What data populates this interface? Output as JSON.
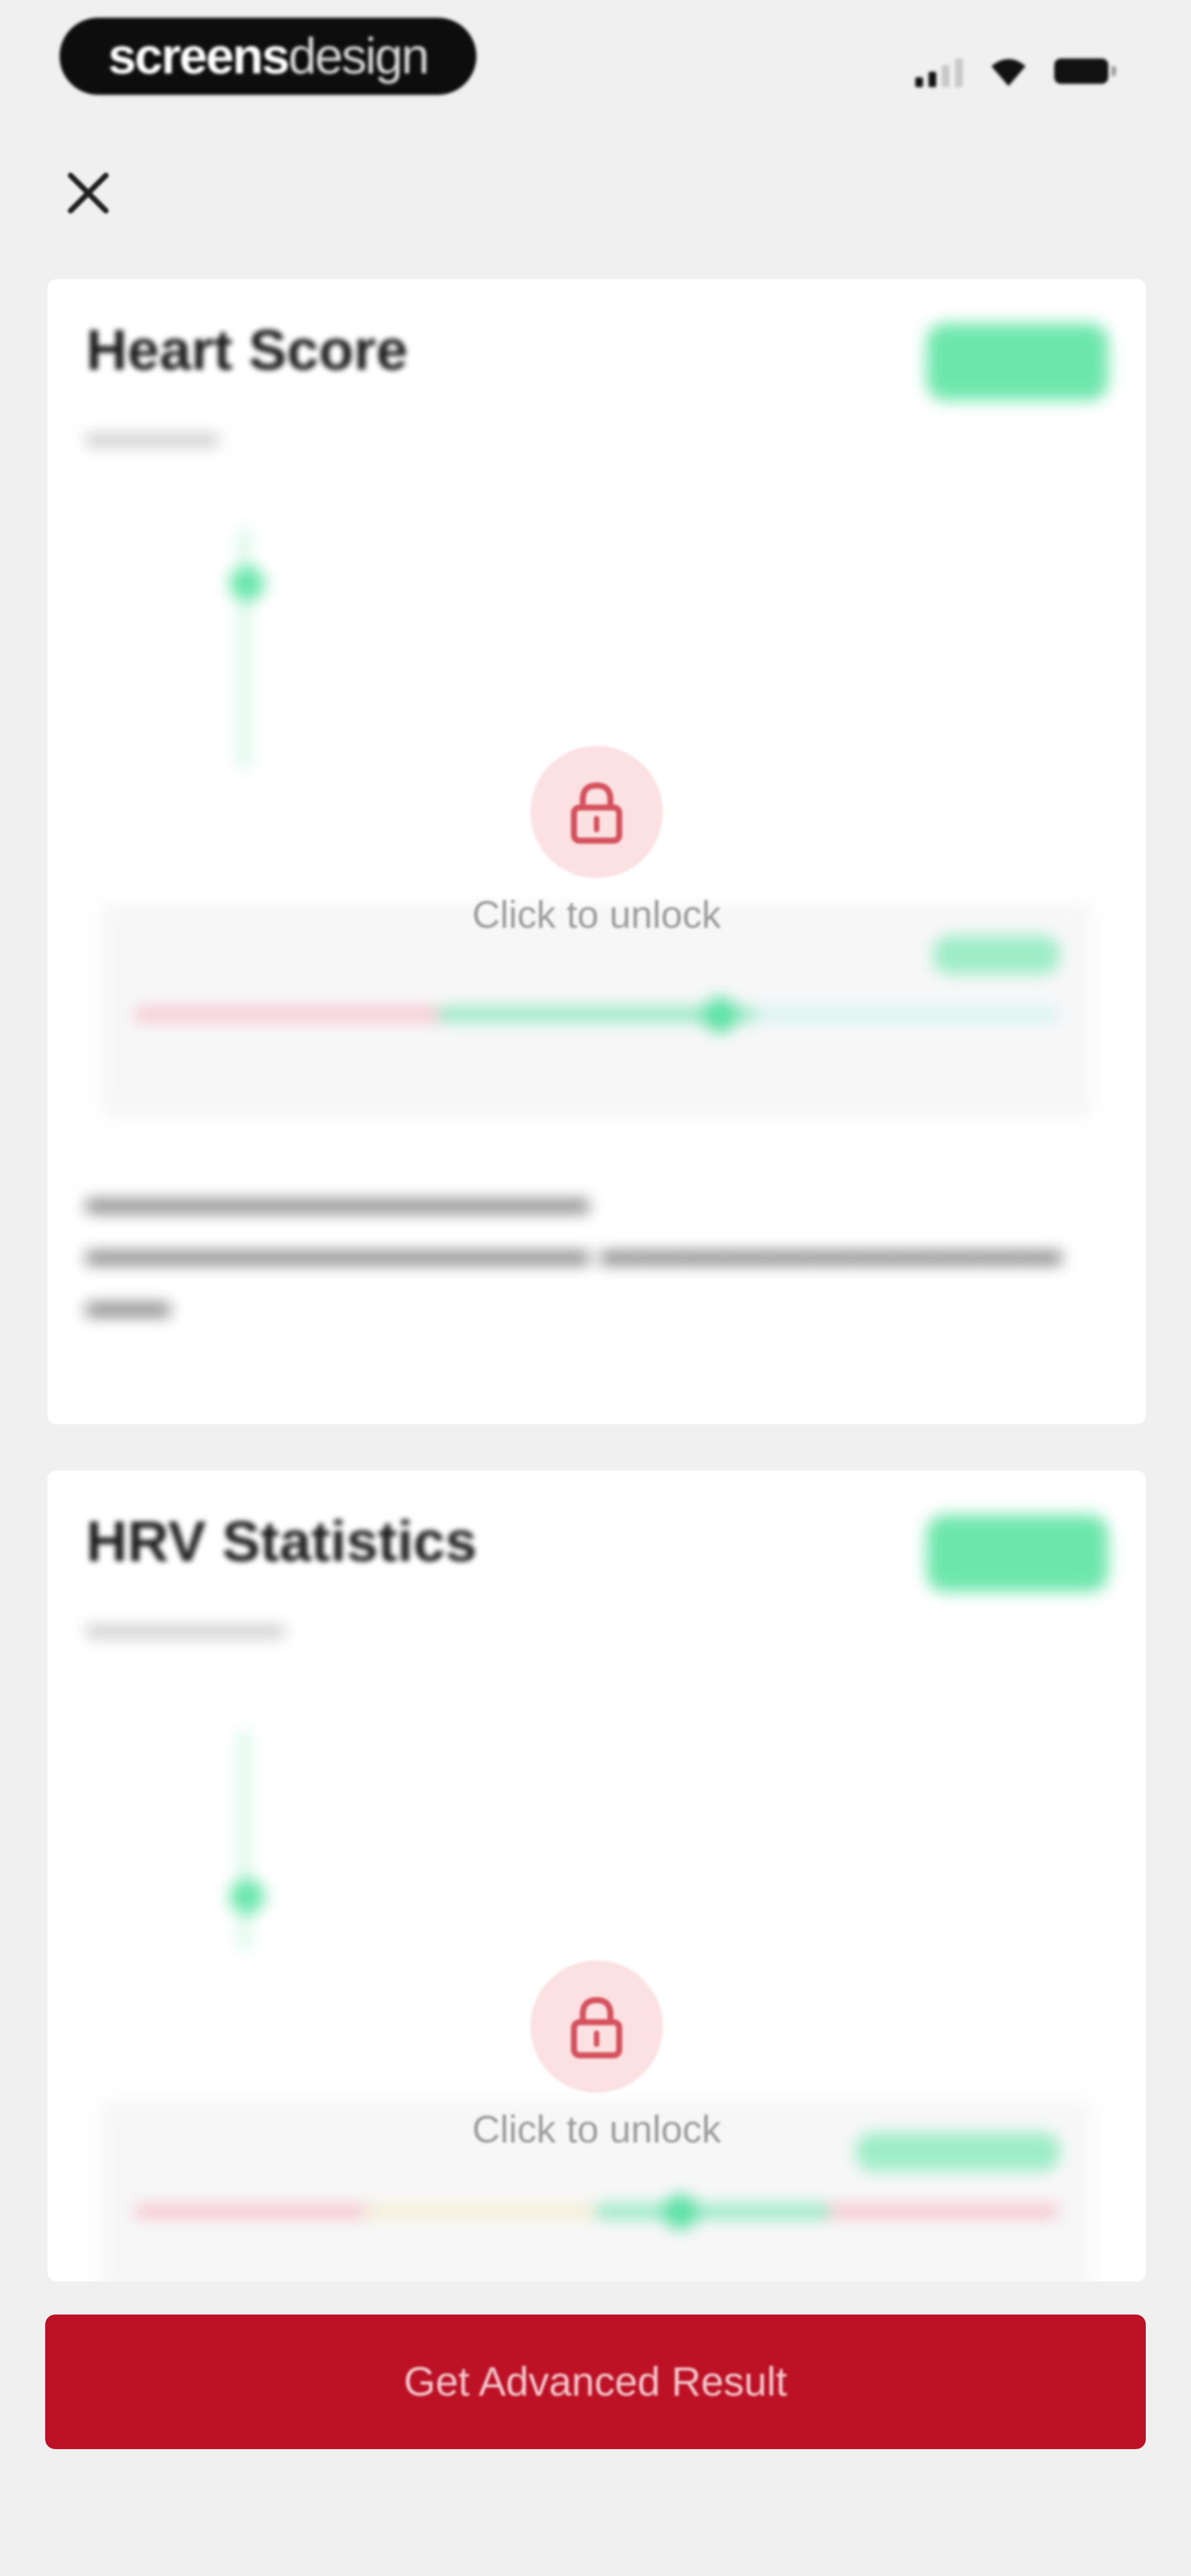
{
  "status_bar": {
    "brand_bold": "screens",
    "brand_light": "design"
  },
  "cards": [
    {
      "title": "Heart Score",
      "badge_color": "#5ee4a4",
      "locked": true,
      "unlock_label": "Click to unlock"
    },
    {
      "title": "HRV Statistics",
      "badge_color": "#5ee4a4",
      "locked": true,
      "unlock_label": "Click to unlock"
    }
  ],
  "cta": {
    "label": "Get Advanced Result",
    "color": "#bd1226"
  },
  "icons": {
    "close": "close-icon",
    "lock": "lock-icon"
  }
}
